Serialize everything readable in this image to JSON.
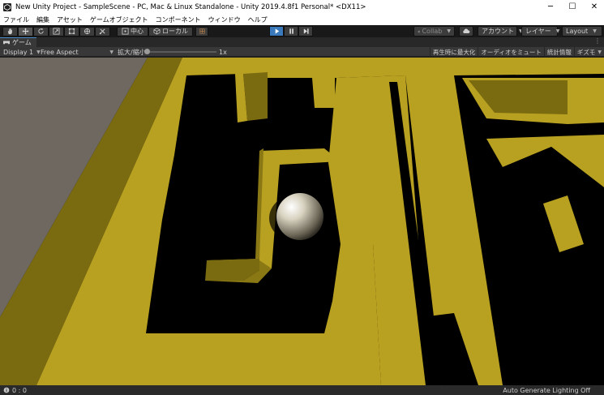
{
  "window": {
    "title": "New Unity Project - SampleScene - PC, Mac & Linux Standalone - Unity 2019.4.8f1 Personal* <DX11>",
    "minimize_glyph": "─",
    "maximize_glyph": "☐",
    "close_glyph": "✕"
  },
  "menu": [
    {
      "label": "ファイル"
    },
    {
      "label": "編集"
    },
    {
      "label": "アセット"
    },
    {
      "label": "ゲームオブジェクト"
    },
    {
      "label": "コンポーネント"
    },
    {
      "label": "ウィンドウ"
    },
    {
      "label": "ヘルプ"
    }
  ],
  "toolbar": {
    "tools": [
      "hand-icon",
      "move-icon",
      "rotate-icon",
      "scale-icon",
      "rect-icon",
      "transform-icon",
      "custom-tool-icon"
    ],
    "pivot_label": "中心",
    "space_label": "ローカル",
    "collab_label": "Collab",
    "account_label": "アカウント",
    "layers_label": "レイヤー",
    "layout_label": "Layout"
  },
  "game_view": {
    "tab_label": "ゲーム",
    "display_label": "Display 1",
    "aspect_label": "Free Aspect",
    "scale_label": "拡大/縮小",
    "scale_value": "1x",
    "toggles": [
      "再生時に最大化",
      "オーディオをミュート",
      "統計情報",
      "ギズモ"
    ]
  },
  "status": {
    "left_text": "0 : 0",
    "right_text": "Auto Generate Lighting Off"
  },
  "colors": {
    "wall_top": "#b8a021",
    "wall_side": "#7a6a10",
    "floor_gray": "#6e6860",
    "play_blue": "#3a79bb"
  }
}
